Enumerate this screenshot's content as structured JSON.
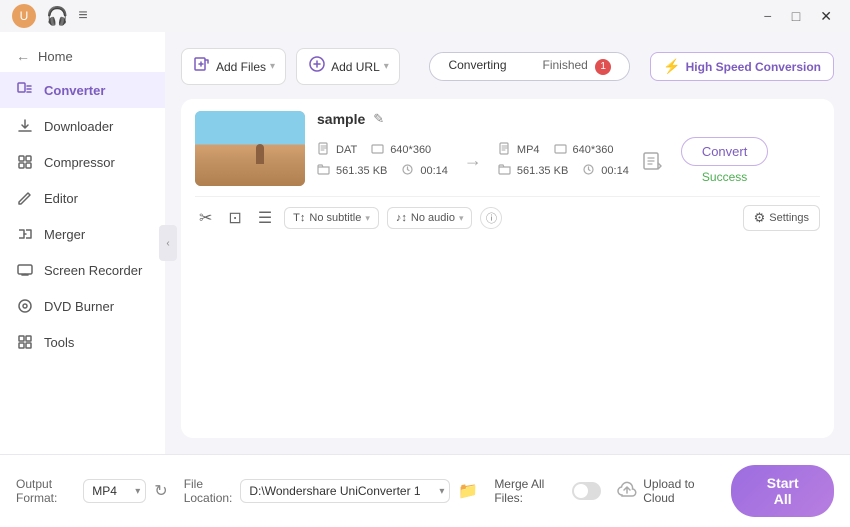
{
  "titlebar": {
    "avatar_color": "#e8a060",
    "avatar_initials": "U",
    "minimize_label": "−",
    "maximize_label": "□",
    "close_label": "✕"
  },
  "sidebar": {
    "home_label": "Home",
    "collapse_icon": "‹",
    "items": [
      {
        "id": "converter",
        "label": "Converter",
        "active": true,
        "icon": "converter"
      },
      {
        "id": "downloader",
        "label": "Downloader",
        "active": false,
        "icon": "downloader"
      },
      {
        "id": "compressor",
        "label": "Compressor",
        "active": false,
        "icon": "compressor"
      },
      {
        "id": "editor",
        "label": "Editor",
        "active": false,
        "icon": "editor"
      },
      {
        "id": "merger",
        "label": "Merger",
        "active": false,
        "icon": "merger"
      },
      {
        "id": "screen-recorder",
        "label": "Screen Recorder",
        "active": false,
        "icon": "screen"
      },
      {
        "id": "dvd-burner",
        "label": "DVD Burner",
        "active": false,
        "icon": "dvd"
      },
      {
        "id": "tools",
        "label": "Tools",
        "active": false,
        "icon": "tools"
      }
    ]
  },
  "toolbar": {
    "add_file_label": "Add Files",
    "add_url_label": "Add URL",
    "tabs": [
      {
        "id": "converting",
        "label": "Converting",
        "active": true,
        "badge": null
      },
      {
        "id": "finished",
        "label": "Finished",
        "active": false,
        "badge": "1"
      }
    ],
    "speed_label": "High Speed Conversion"
  },
  "file_card": {
    "filename": "sample",
    "source": {
      "format": "DAT",
      "resolution": "640*360",
      "size": "561.35 KB",
      "duration": "00:14"
    },
    "target": {
      "format": "MP4",
      "resolution": "640*360",
      "size": "561.35 KB",
      "duration": "00:14"
    },
    "convert_btn_label": "Convert",
    "status_label": "Success",
    "subtitle_label": "No subtitle",
    "audio_label": "No audio",
    "settings_label": "Settings"
  },
  "bottom_bar": {
    "output_format_label": "Output Format:",
    "output_format_value": "MP4",
    "file_location_label": "File Location:",
    "file_location_value": "D:\\Wondershare UniConverter 1",
    "merge_label": "Merge All Files:",
    "upload_cloud_label": "Upload to Cloud",
    "start_btn_label": "Start All"
  }
}
